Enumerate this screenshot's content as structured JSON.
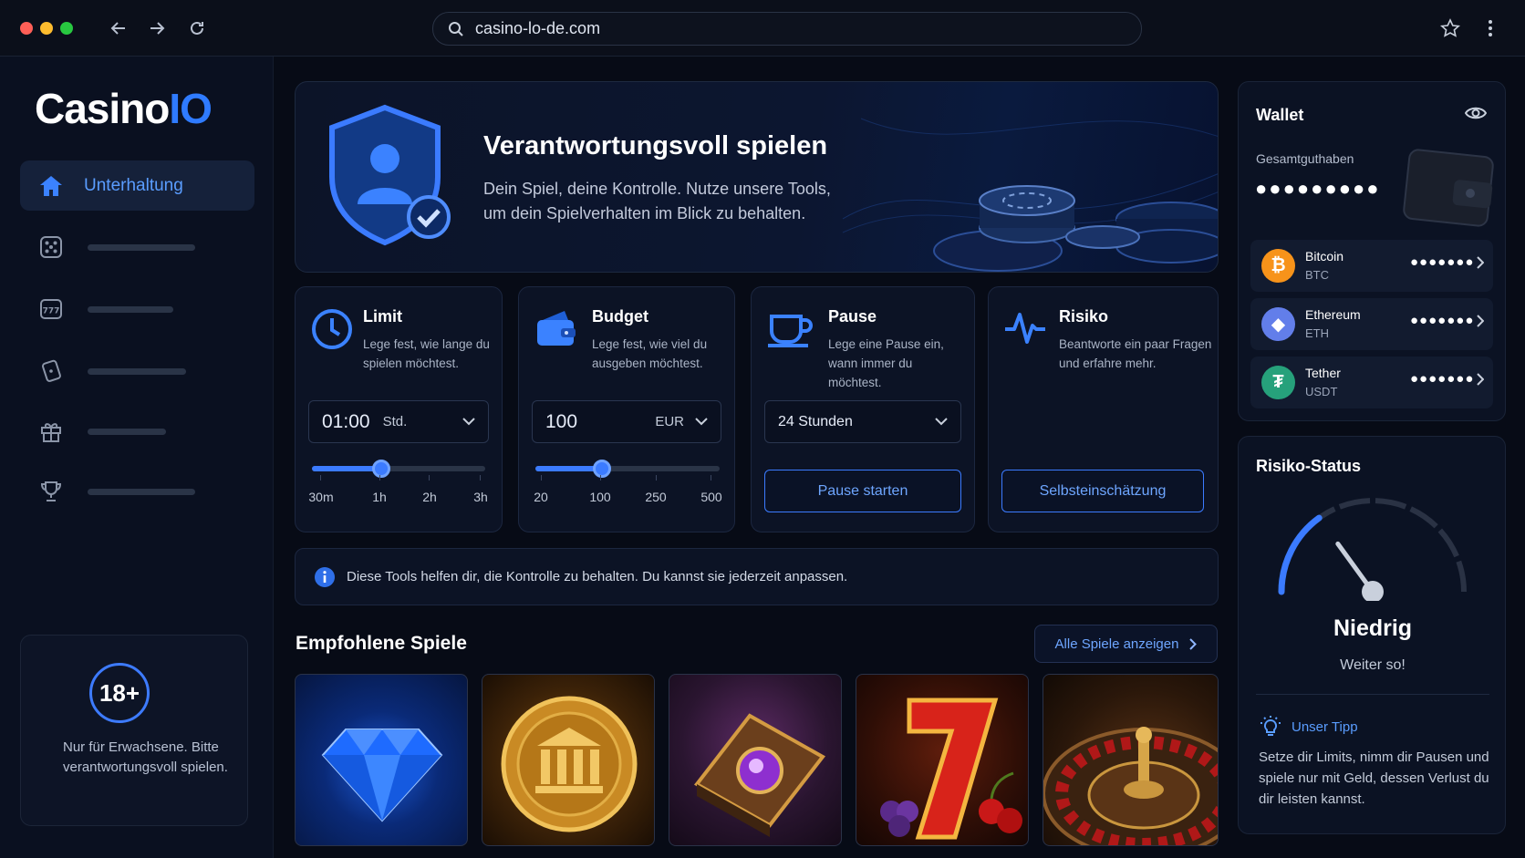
{
  "browser": {
    "url": "casino-lo-de.com"
  },
  "brand": {
    "name_main": "Casino",
    "name_accent": "IO",
    "accent": "#2f7bff"
  },
  "sidebar": {
    "active_label": "Unterhaltung",
    "items": [
      {
        "icon": "home-icon"
      },
      {
        "icon": "dice-icon"
      },
      {
        "icon": "slot-777-icon"
      },
      {
        "icon": "card-icon"
      },
      {
        "icon": "gift-icon"
      },
      {
        "icon": "trophy-icon"
      }
    ],
    "age": {
      "badge": "18+",
      "text": "Nur für Erwachsene. Bitte verantwortungsvoll spielen."
    }
  },
  "hero": {
    "title": "Verantwortungsvoll spielen",
    "subtitle": "Dein Spiel, deine Kontrolle. Nutze unsere Tools, um dein Spielverhalten im Blick zu behalten."
  },
  "tools": {
    "limit": {
      "title": "Limit",
      "desc": "Lege fest, wie lange du spielen möchtest.",
      "value": "01:00",
      "unit": "Std.",
      "ticks": [
        "30m",
        "1h",
        "2h",
        "3h"
      ],
      "slider_level": 0.4
    },
    "budget": {
      "title": "Budget",
      "desc": "Lege fest, wie viel du ausgeben möchtest.",
      "value": "100",
      "unit": "EUR",
      "ticks": [
        "20",
        "100",
        "250",
        "500"
      ],
      "slider_level": 0.36
    },
    "pause": {
      "title": "Pause",
      "desc": "Lege eine Pause ein, wann immer du möchtest.",
      "value": "24 Stunden",
      "button": "Pause starten"
    },
    "risiko": {
      "title": "Risiko",
      "desc": "Beantworte ein paar Fragen und erfahre mehr.",
      "button": "Selbsteinschätzung"
    }
  },
  "info": {
    "text": "Diese Tools helfen dir, die Kontrolle zu behalten. Du kannst sie jederzeit anpassen."
  },
  "games": {
    "title": "Empfohlene Spiele",
    "all_label": "Alle Spiele anzeigen",
    "tiles": [
      {
        "icon": "diamond-icon"
      },
      {
        "icon": "bank-coin-icon"
      },
      {
        "icon": "spell-book-icon"
      },
      {
        "icon": "seven-fruits-icon"
      },
      {
        "icon": "roulette-icon"
      }
    ]
  },
  "wallet": {
    "title": "Wallet",
    "total_label": "Gesamtguthaben",
    "total_masked": "●●●●●●●●●",
    "coins": [
      {
        "name": "Bitcoin",
        "symbol": "BTC",
        "masked": "●●●●●●●",
        "color": "#f7931a",
        "glyph": "₿"
      },
      {
        "name": "Ethereum",
        "symbol": "ETH",
        "masked": "●●●●●●●",
        "color": "#627eea",
        "glyph": "◆"
      },
      {
        "name": "Tether",
        "symbol": "USDT",
        "masked": "●●●●●●●",
        "color": "#26a17b",
        "glyph": "₮"
      }
    ]
  },
  "risk_status": {
    "title": "Risiko-Status",
    "level": "Niedrig",
    "message": "Weiter so!",
    "gauge_value": 0.3,
    "tip_label": "Unser Tipp",
    "tip_text": "Setze dir Limits, nimm dir Pausen und spiele nur mit Geld, dessen Verlust du dir leisten kannst."
  }
}
